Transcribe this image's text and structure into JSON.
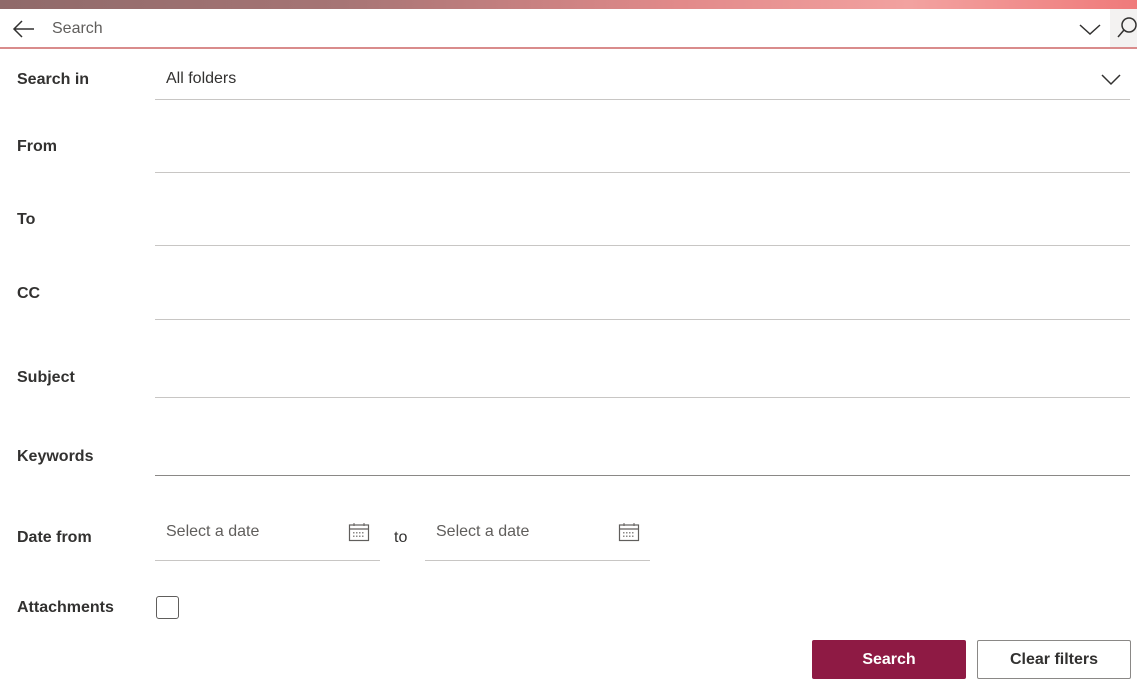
{
  "searchbar": {
    "placeholder": "Search"
  },
  "form": {
    "search_in": {
      "label": "Search in",
      "value": "All folders"
    },
    "from": {
      "label": "From",
      "value": ""
    },
    "to": {
      "label": "To",
      "value": ""
    },
    "cc": {
      "label": "CC",
      "value": ""
    },
    "subject": {
      "label": "Subject",
      "value": ""
    },
    "keywords": {
      "label": "Keywords",
      "value": ""
    },
    "date": {
      "label": "Date from",
      "from_placeholder": "Select a date",
      "separator": "to",
      "to_placeholder": "Select a date"
    },
    "attachments": {
      "label": "Attachments",
      "checked": false
    }
  },
  "buttons": {
    "search": "Search",
    "clear": "Clear filters"
  },
  "colors": {
    "primary": "#8e1a44"
  }
}
